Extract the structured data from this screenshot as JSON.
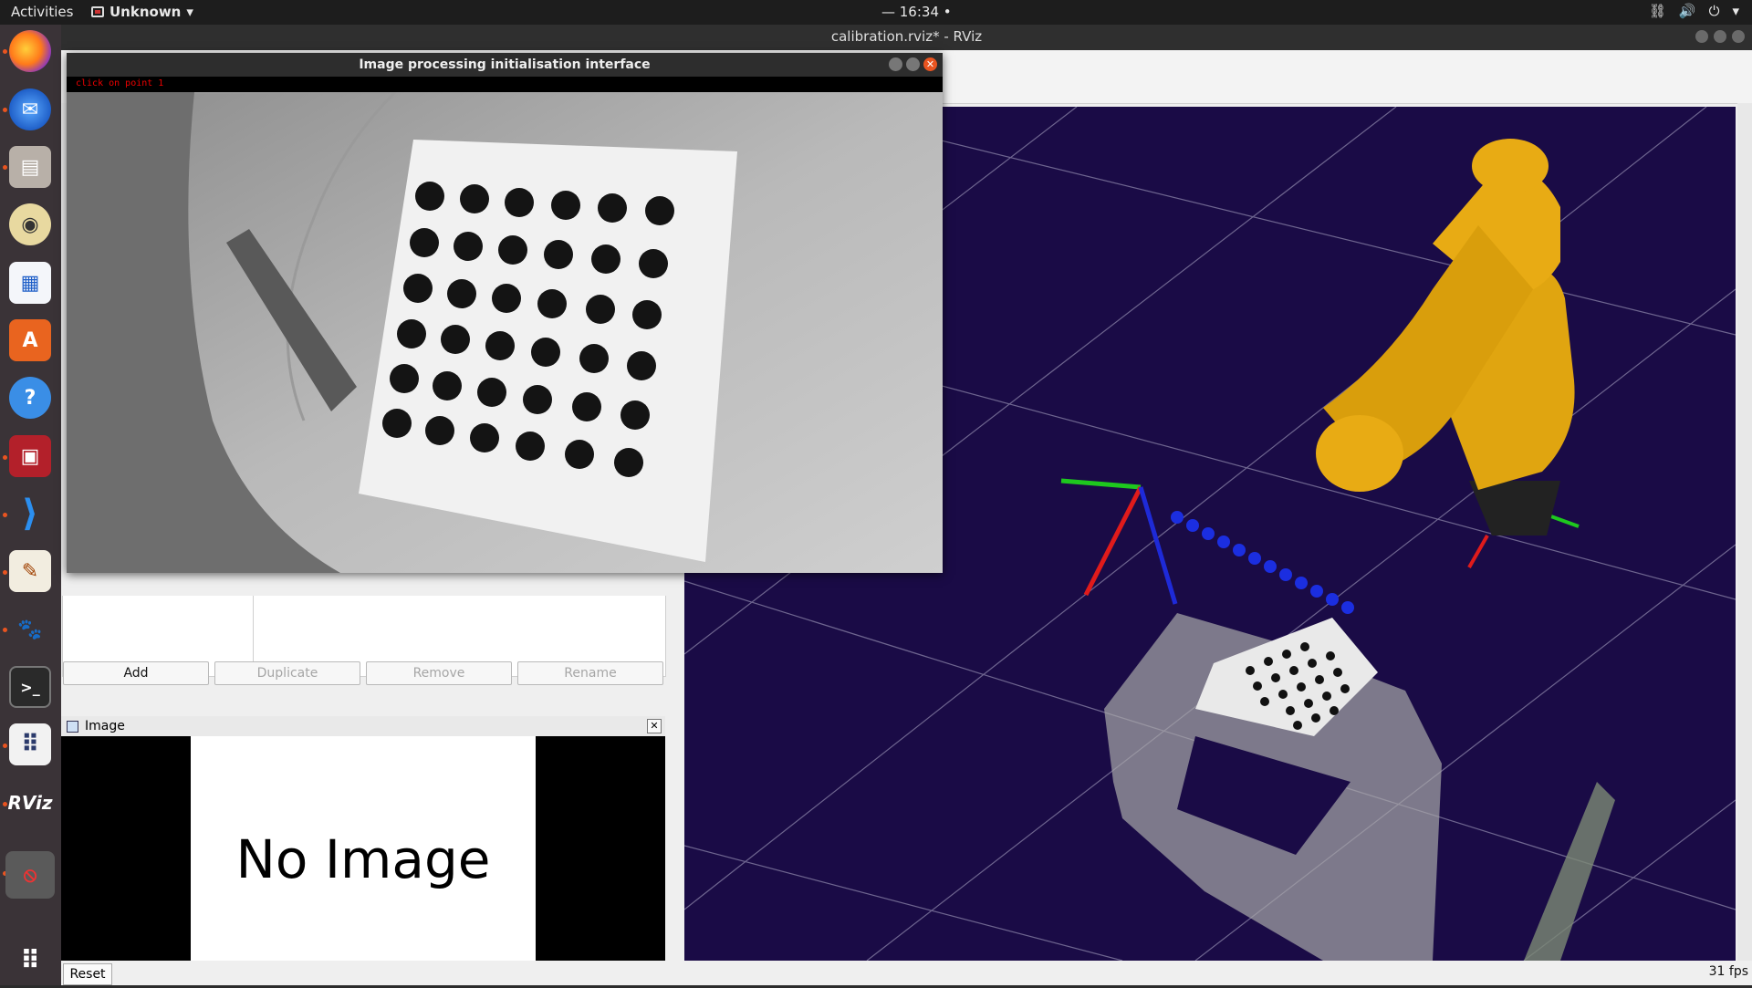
{
  "topbar": {
    "activities": "Activities",
    "app_menu": "Unknown",
    "clock": "— 16:34 •"
  },
  "dock": {
    "items": [
      "firefox-icon",
      "thunderbird-icon",
      "files-icon",
      "rhythmbox-icon",
      "writer-icon",
      "software-icon",
      "help-icon",
      "app-icon",
      "vscode-icon",
      "text-editor-icon",
      "gimp-icon",
      "terminal-icon",
      "dots-icon",
      "rviz-icon",
      "blocked-icon",
      "show-apps-icon"
    ]
  },
  "rviz": {
    "title": "calibration.rviz* - RViz",
    "buttons": {
      "add": "Add",
      "duplicate": "Duplicate",
      "remove": "Remove",
      "rename": "Rename"
    },
    "image_panel": {
      "title": "Image",
      "no_image": "No Image"
    },
    "reset": "Reset",
    "fps": "31 fps"
  },
  "ip_window": {
    "title": "Image processing initialisation interface",
    "status": "click on point 1"
  },
  "colors": {
    "viewport_bg": "#1a0b46",
    "robot": "#e8ab14",
    "accent": "#e95420"
  }
}
